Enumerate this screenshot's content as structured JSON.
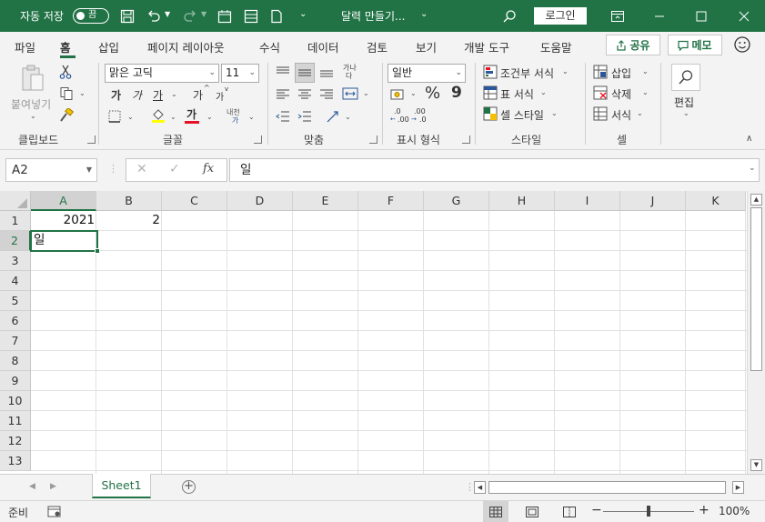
{
  "titlebar": {
    "autosave_label": "자동 저장",
    "autosave_state": "끔",
    "doc_title": "달력 만들기...",
    "login_label": "로그인"
  },
  "tabs": [
    "파일",
    "홈",
    "삽입",
    "페이지 레이아웃",
    "수식",
    "데이터",
    "검토",
    "보기",
    "개발 도구",
    "도움말"
  ],
  "active_tab": "홈",
  "share_label": "공유",
  "memo_label": "메모",
  "ribbon": {
    "clipboard": {
      "paste_label": "붙여넣기",
      "group_label": "클립보드"
    },
    "font": {
      "font_name": "맑은 고딕",
      "font_size": "11",
      "bold": "가",
      "italic": "가",
      "underline": "가",
      "grow": "가",
      "shrink": "가",
      "font_color": "가",
      "phonetic_top": "내천",
      "phonetic_bottom": "가",
      "group_label": "글꼴"
    },
    "alignment": {
      "wrap_top": "가나",
      "wrap_bottom": "다",
      "group_label": "맞춤"
    },
    "number": {
      "format": "일반",
      "percent": "%",
      "comma": "9",
      "inc_decimal_top": ".0",
      "inc_decimal_bottom": ".00",
      "dec_decimal_top": ".00",
      "dec_decimal_bottom": ".0",
      "inc_decimal_arrow": "←",
      "dec_decimal_arrow": "→",
      "group_label": "표시 형식"
    },
    "styles": {
      "conditional": "조건부 서식",
      "table": "표 서식",
      "cell_styles": "셀 스타일",
      "group_label": "스타일"
    },
    "cells": {
      "insert": "삽입",
      "delete": "삭제",
      "format": "서식",
      "group_label": "셀"
    },
    "editing": {
      "label": "편집"
    }
  },
  "formula_bar": {
    "name_box": "A2",
    "fx_label": "fx",
    "formula": "일"
  },
  "grid": {
    "columns": [
      "A",
      "B",
      "C",
      "D",
      "E",
      "F",
      "G",
      "H",
      "I",
      "J",
      "K"
    ],
    "rows": [
      "1",
      "2",
      "3",
      "4",
      "5",
      "6",
      "7",
      "8",
      "9",
      "10",
      "11",
      "12",
      "13"
    ],
    "selected_cell": "A2",
    "cells": {
      "A1": "2021",
      "B1": "2",
      "A2": "일"
    }
  },
  "sheets": [
    "Sheet1"
  ],
  "add_sheet_symbol": "+",
  "status": {
    "ready": "준비",
    "zoom": "100%",
    "zoom_minus": "−",
    "zoom_plus": "+"
  },
  "colors": {
    "brand": "#217346",
    "font_color_bar": "#e81123",
    "fill_color_bar": "#ffff00"
  }
}
